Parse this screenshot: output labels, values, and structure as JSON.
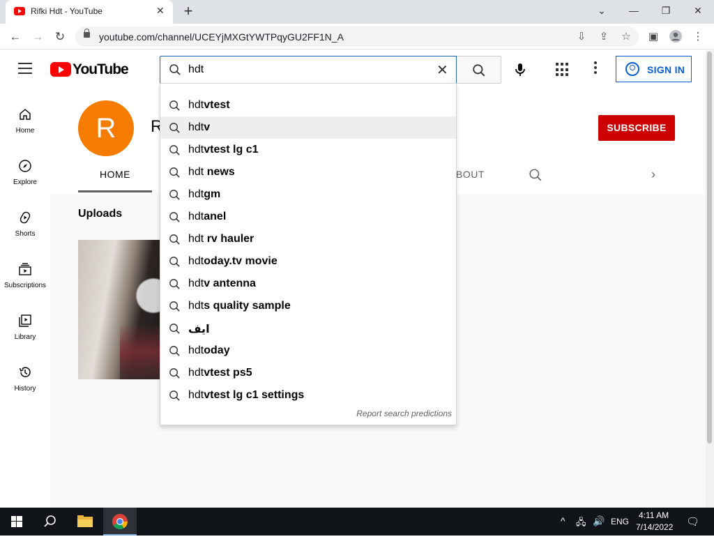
{
  "browser": {
    "tab_title": "Rifki Hdt - YouTube",
    "url": "youtube.com/channel/UCEYjMXGtYWTPqyGU2FF1N_A"
  },
  "youtube": {
    "logo_text": "YouTube",
    "search_query": "hdt",
    "signin_label": "SIGN IN",
    "sidebar": [
      {
        "label": "Home",
        "icon": "home-icon"
      },
      {
        "label": "Explore",
        "icon": "compass-icon"
      },
      {
        "label": "Shorts",
        "icon": "shorts-icon"
      },
      {
        "label": "Subscriptions",
        "icon": "subscriptions-icon"
      },
      {
        "label": "Library",
        "icon": "library-icon"
      },
      {
        "label": "History",
        "icon": "history-icon"
      }
    ],
    "channel": {
      "avatar_letter": "R",
      "name_visible": "R",
      "subscribe_label": "SUBSCRIBE",
      "tabs": {
        "home": "HOME",
        "about_partial": "BOUT"
      }
    },
    "uploads_title": "Uploads",
    "suggestions": [
      {
        "prefix": "hdt",
        "rest": "vtest"
      },
      {
        "prefix": "hdt",
        "rest": "v"
      },
      {
        "prefix": "hdt",
        "rest": "vtest lg c1"
      },
      {
        "prefix": "hdt",
        "rest": " news"
      },
      {
        "prefix": "hdt",
        "rest": "gm"
      },
      {
        "prefix": "hdt",
        "rest": "anel"
      },
      {
        "prefix": "hdt",
        "rest": " rv hauler"
      },
      {
        "prefix": "hdt",
        "rest": "oday.tv movie"
      },
      {
        "prefix": "hdt",
        "rest": "v antenna"
      },
      {
        "prefix": "hdt",
        "rest": "s quality sample"
      },
      {
        "prefix": "",
        "rest": "ايف"
      },
      {
        "prefix": "hdt",
        "rest": "oday"
      },
      {
        "prefix": "hdt",
        "rest": "vtest ps5"
      },
      {
        "prefix": "hdt",
        "rest": "vtest lg c1 settings"
      }
    ],
    "highlighted_suggestion": 1,
    "report_label": "Report search predictions",
    "colors": {
      "brand_red": "#ff0000",
      "subscribe_red": "#cc0000",
      "link_blue": "#065fd4",
      "avatar_orange": "#f57c00"
    }
  },
  "taskbar": {
    "language": "ENG",
    "time": "4:11 AM",
    "date": "7/14/2022"
  }
}
